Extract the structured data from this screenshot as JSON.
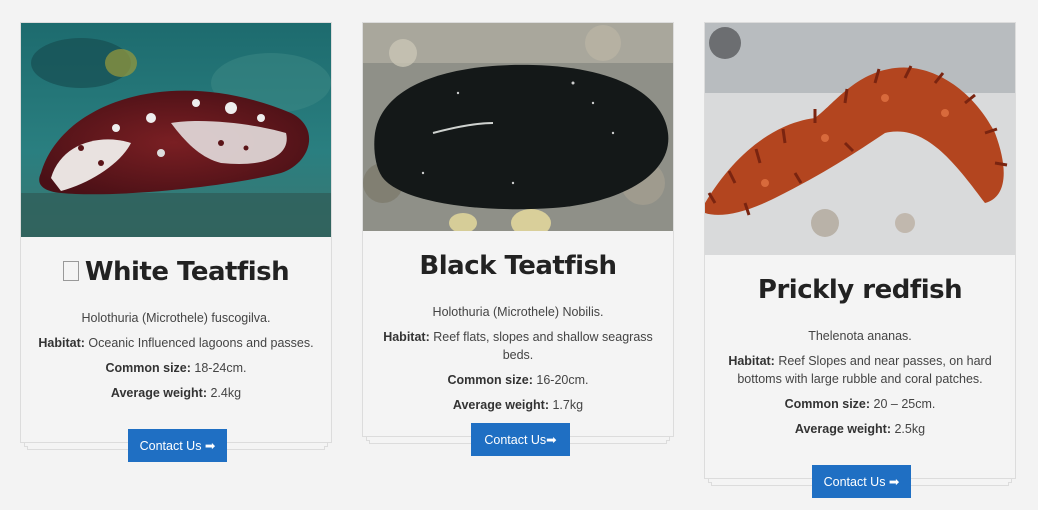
{
  "cards": [
    {
      "title": "White Teatfish",
      "scientific": "Holothuria (Microthele) fuscogilva.",
      "habitat_label": "Habitat:",
      "habitat": "Oceanic Influenced lagoons and passes.",
      "size_label": "Common size:",
      "size": "18-24cm.",
      "weight_label": "Average weight:",
      "weight": "2.4kg",
      "button": "Contact Us ➡"
    },
    {
      "title": "Black Teatfish",
      "scientific": "Holothuria (Microthele) Nobilis.",
      "habitat_label": "Habitat:",
      "habitat": "Reef flats, slopes and shallow seagrass beds.",
      "size_label": "Common size:",
      "size": "16-20cm.",
      "weight_label": "Average weight:",
      "weight": "1.7kg",
      "button": "Contact Us➡"
    },
    {
      "title": "Prickly redfish",
      "scientific": "Thelenota ananas.",
      "habitat_label": "Habitat:",
      "habitat": "Reef Slopes and near passes, on hard bottoms with large rubble and coral patches.",
      "size_label": "Common size:",
      "size": "20 – 25cm.",
      "weight_label": "Average weight:",
      "weight": "2.5kg",
      "button": "Contact Us ➡"
    }
  ],
  "colors": {
    "button": "#1f6fc3",
    "card": "#f4f4f4",
    "page": "#f3f3f3"
  }
}
